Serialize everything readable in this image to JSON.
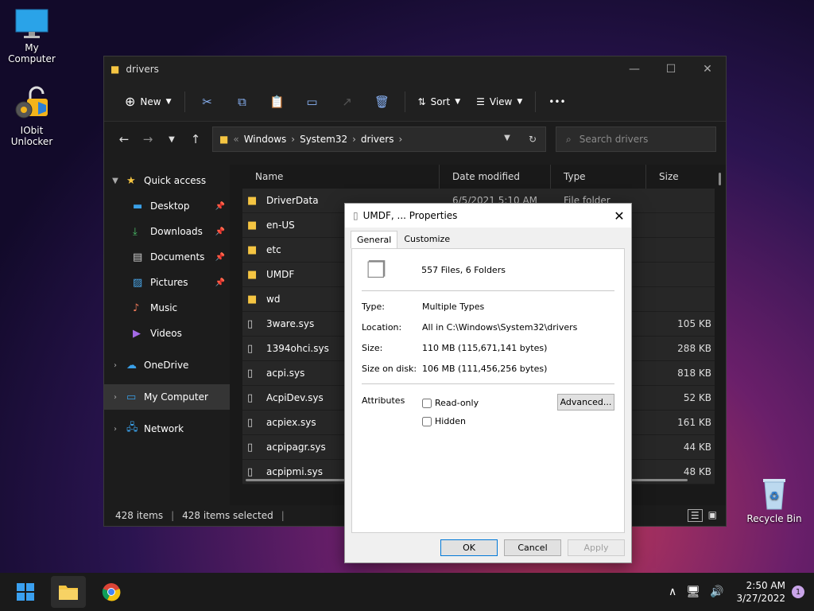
{
  "desktop": {
    "icons": [
      {
        "label": "My Computer"
      },
      {
        "label": "IObit Unlocker"
      },
      {
        "label": "Recycle Bin"
      }
    ]
  },
  "explorer": {
    "title": "drivers",
    "toolbar": {
      "new_label": "New",
      "sort_label": "Sort",
      "view_label": "View",
      "more_label": "•••"
    },
    "address": {
      "crumbs": [
        "Windows",
        "System32",
        "drivers"
      ],
      "overflow": "«"
    },
    "search": {
      "placeholder": "Search drivers"
    },
    "nav": {
      "quick_access": "Quick access",
      "items": [
        "Desktop",
        "Downloads",
        "Documents",
        "Pictures",
        "Music",
        "Videos"
      ],
      "onedrive": "OneDrive",
      "my_computer": "My Computer",
      "network": "Network"
    },
    "columns": {
      "name": "Name",
      "date": "Date modified",
      "type": "Type",
      "size": "Size"
    },
    "files": [
      {
        "name": "DriverData",
        "date": "6/5/2021 5:10 AM",
        "type": "File folder",
        "size": "",
        "kind": "folder"
      },
      {
        "name": "en-US",
        "date": "",
        "type": "",
        "size": "",
        "kind": "folder"
      },
      {
        "name": "etc",
        "date": "",
        "type": "",
        "size": "",
        "kind": "folder"
      },
      {
        "name": "UMDF",
        "date": "",
        "type": "",
        "size": "",
        "kind": "folder"
      },
      {
        "name": "wd",
        "date": "",
        "type": "",
        "size": "",
        "kind": "folder"
      },
      {
        "name": "3ware.sys",
        "date": "",
        "type": "",
        "size": "105 KB",
        "kind": "file"
      },
      {
        "name": "1394ohci.sys",
        "date": "",
        "type": "",
        "size": "288 KB",
        "kind": "file"
      },
      {
        "name": "acpi.sys",
        "date": "",
        "type": "",
        "size": "818 KB",
        "kind": "file"
      },
      {
        "name": "AcpiDev.sys",
        "date": "",
        "type": "",
        "size": "52 KB",
        "kind": "file"
      },
      {
        "name": "acpiex.sys",
        "date": "",
        "type": "",
        "size": "161 KB",
        "kind": "file"
      },
      {
        "name": "acpipagr.sys",
        "date": "",
        "type": "",
        "size": "44 KB",
        "kind": "file"
      },
      {
        "name": "acpipmi.sys",
        "date": "",
        "type": "",
        "size": "48 KB",
        "kind": "file"
      }
    ],
    "status": {
      "count": "428 items",
      "selected": "428 items selected"
    }
  },
  "dialog": {
    "title": "UMDF, ... Properties",
    "tabs": [
      "General",
      "Customize"
    ],
    "summary": "557 Files, 6 Folders",
    "props": [
      {
        "k": "Type:",
        "v": "Multiple Types"
      },
      {
        "k": "Location:",
        "v": "All in C:\\Windows\\System32\\drivers"
      },
      {
        "k": "Size:",
        "v": "110 MB (115,671,141 bytes)"
      },
      {
        "k": "Size on disk:",
        "v": "106 MB (111,456,256 bytes)"
      }
    ],
    "attributes_label": "Attributes",
    "readonly_label": "Read-only",
    "hidden_label": "Hidden",
    "advanced_label": "Advanced...",
    "ok_label": "OK",
    "cancel_label": "Cancel",
    "apply_label": "Apply"
  },
  "taskbar": {
    "time": "2:50 AM",
    "date": "3/27/2022",
    "notifications": "1"
  }
}
